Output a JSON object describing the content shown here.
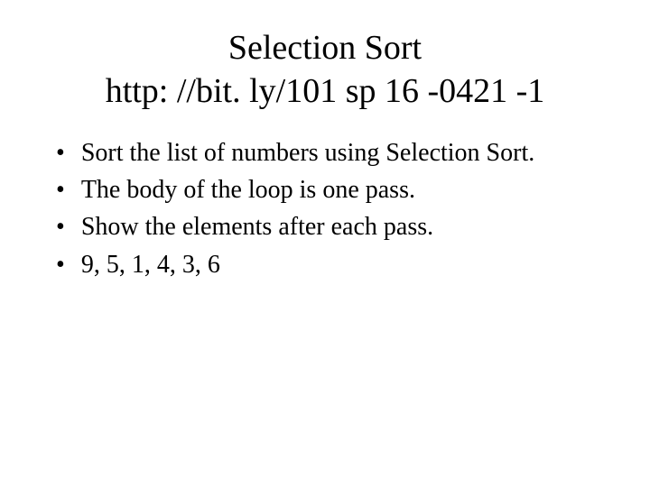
{
  "title": {
    "line1": "Selection Sort",
    "line2": "http: //bit. ly/101 sp 16 -0421 -1"
  },
  "bullets": {
    "marker": "•",
    "items": [
      "Sort the list of numbers using Selection Sort.",
      "The body of the loop is one pass.",
      "Show the elements after each pass.",
      "9, 5, 1, 4, 3, 6"
    ]
  }
}
